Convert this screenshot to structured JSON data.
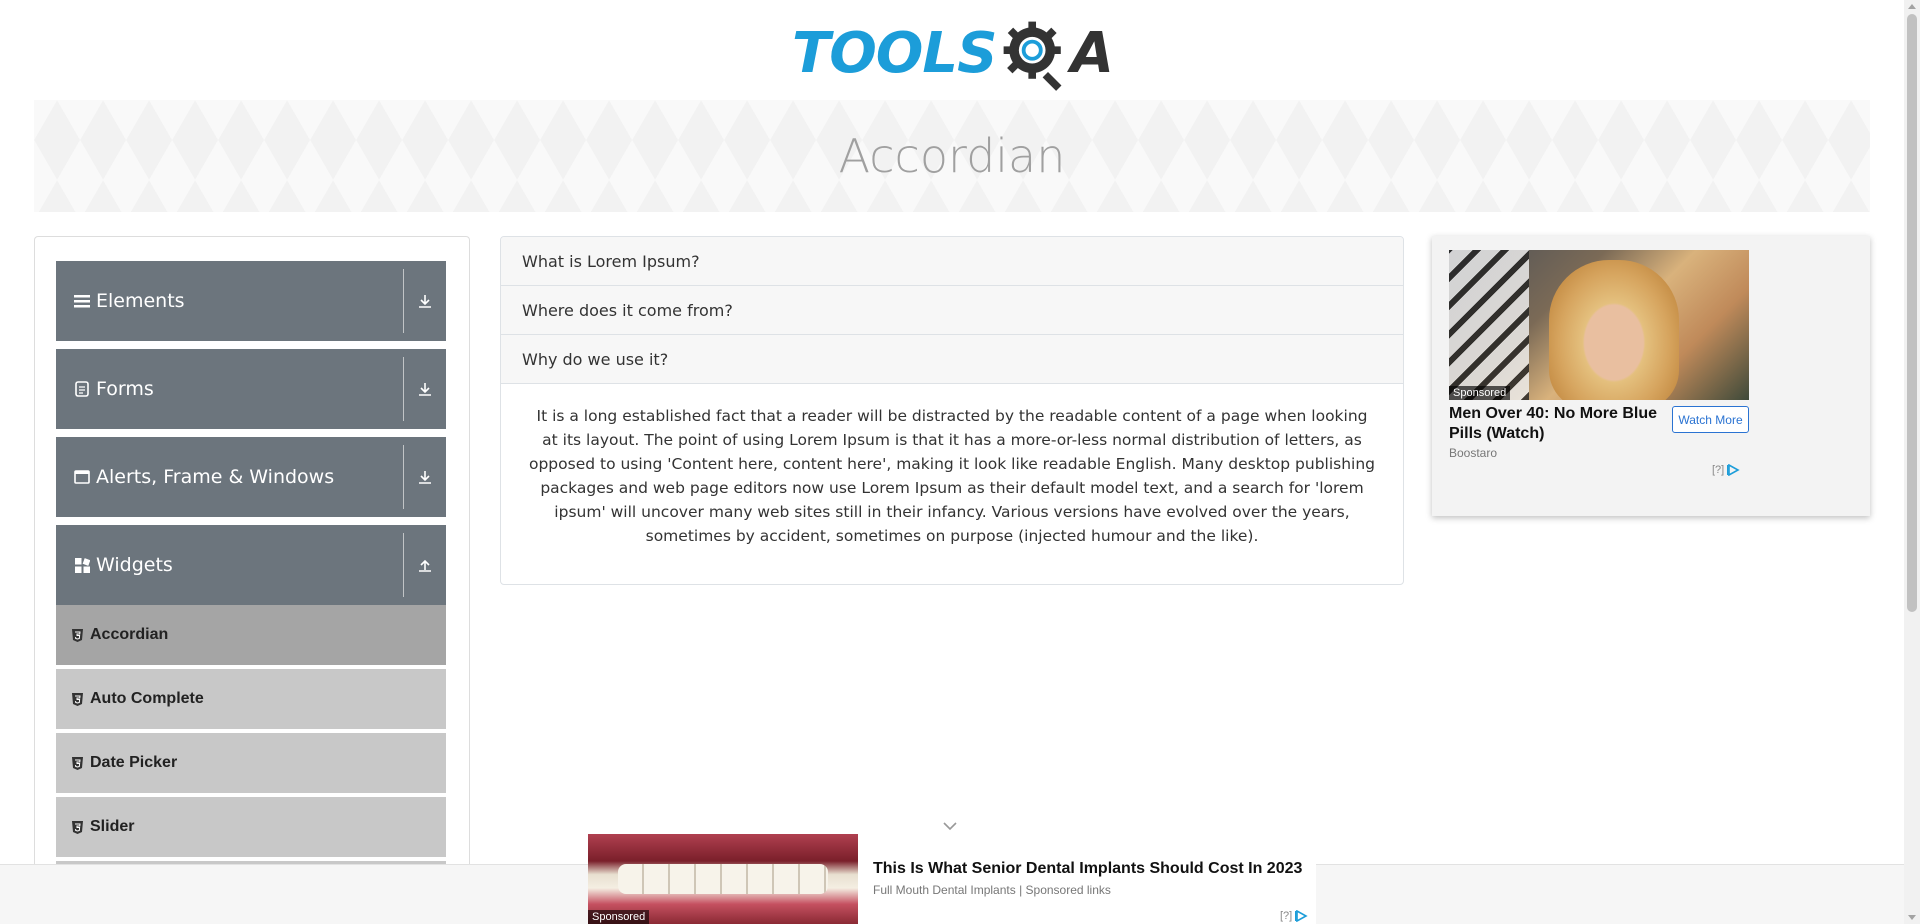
{
  "header": {
    "logo_main": "TOOLS",
    "logo_tail": "A",
    "logo_alt": "TOOLSQA"
  },
  "banner": {
    "title": "Accordian"
  },
  "sidebar": {
    "groups": [
      {
        "label": "Elements",
        "icon": "hamburger-icon",
        "state": "collapsed"
      },
      {
        "label": "Forms",
        "icon": "document-icon",
        "state": "collapsed"
      },
      {
        "label": "Alerts, Frame & Windows",
        "icon": "window-icon",
        "state": "collapsed"
      },
      {
        "label": "Widgets",
        "icon": "grid-icon",
        "state": "expanded"
      }
    ],
    "items": [
      {
        "label": "Accordian",
        "active": true
      },
      {
        "label": "Auto Complete",
        "active": false
      },
      {
        "label": "Date Picker",
        "active": false
      },
      {
        "label": "Slider",
        "active": false
      }
    ]
  },
  "accordion": {
    "sections": [
      {
        "header": "What is Lorem Ipsum?"
      },
      {
        "header": "Where does it come from?"
      },
      {
        "header": "Why do we use it?"
      }
    ],
    "open_body": "It is a long established fact that a reader will be distracted by the readable content of a page when looking at its layout. The point of using Lorem Ipsum is that it has a more-or-less normal distribution of letters, as opposed to using 'Content here, content here', making it look like readable English. Many desktop publishing packages and web page editors now use Lorem Ipsum as their default model text, and a search for 'lorem ipsum' will uncover many web sites still in their infancy. Various versions have evolved over the years, sometimes by accident, sometimes on purpose (injected humour and the like)."
  },
  "ad_right": {
    "tag": "Sponsored",
    "title": "Men Over 40: No More Blue Pills (Watch)",
    "button": "Watch More",
    "source": "Boostaro",
    "info": "[?]"
  },
  "ad_bottom": {
    "tag": "Sponsored",
    "title": "This Is What Senior Dental Implants Should Cost In 2023",
    "source": "Full Mouth Dental Implants | Sponsored links",
    "info": "[?]"
  },
  "colors": {
    "brand_blue": "#1c9dd9",
    "nav_gray": "#6c757d",
    "sub_gray": "#c8c8c8",
    "sub_active": "#a5a5a5"
  }
}
